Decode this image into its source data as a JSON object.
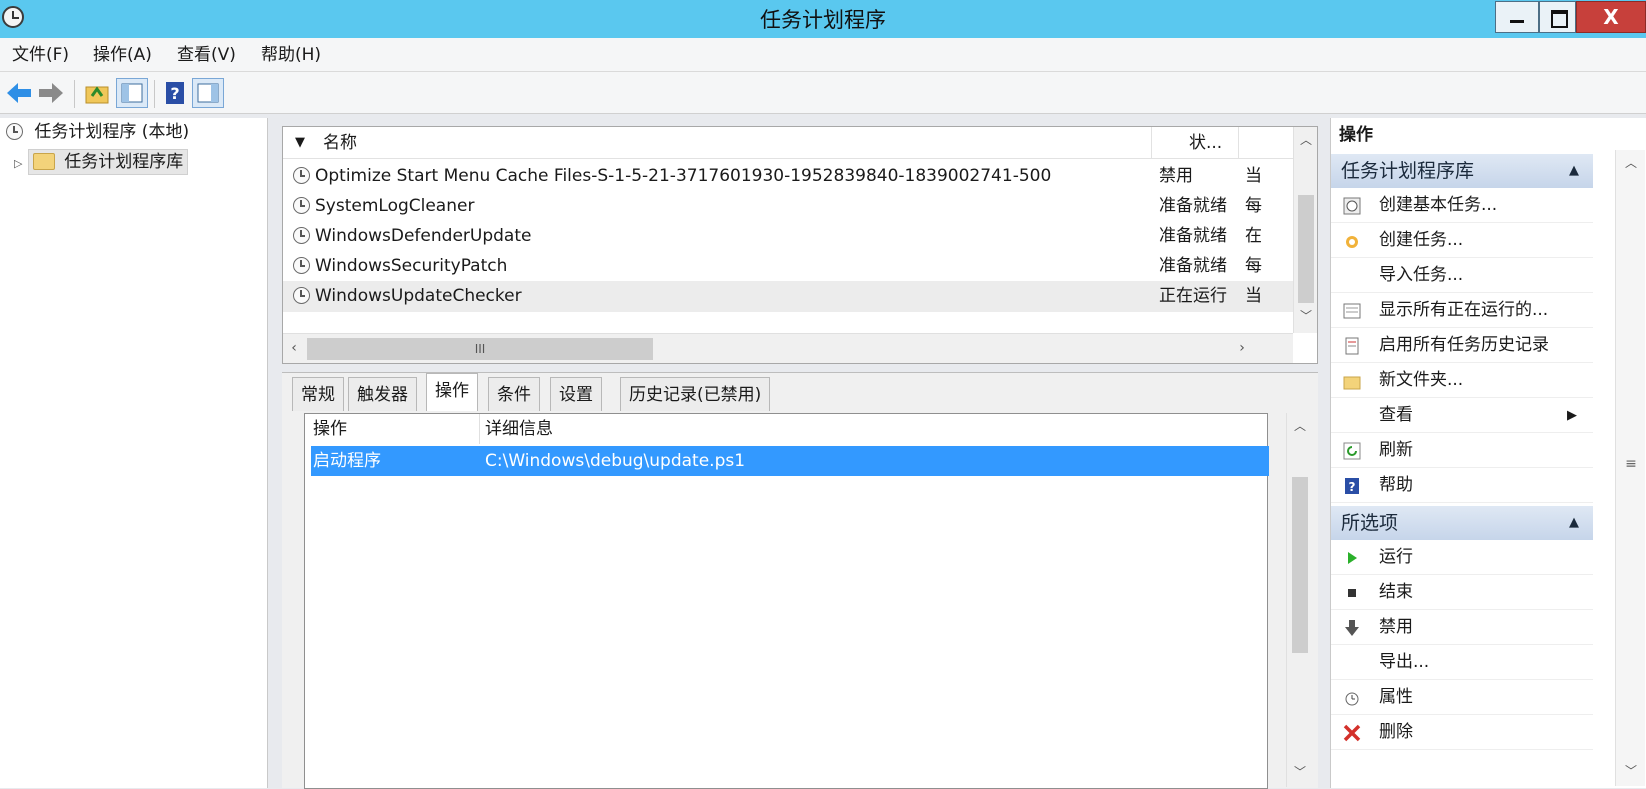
{
  "window": {
    "title": "任务计划程序"
  },
  "menu": [
    "文件(F)",
    "操作(A)",
    "查看(V)",
    "帮助(H)"
  ],
  "tree": {
    "root": "任务计划程序 (本地)",
    "library": "任务计划程序库"
  },
  "task_list": {
    "columns": {
      "name": "名称",
      "status": "状..."
    },
    "scroll_label": "III",
    "rows": [
      {
        "name": "Optimize Start Menu Cache Files-S-1-5-21-3717601930-1952839840-1839002741-500",
        "status": "禁用",
        "trigger": "当"
      },
      {
        "name": "SystemLogCleaner",
        "status": "准备就绪",
        "trigger": "每"
      },
      {
        "name": "WindowsDefenderUpdate",
        "status": "准备就绪",
        "trigger": "在"
      },
      {
        "name": "WindowsSecurityPatch",
        "status": "准备就绪",
        "trigger": "每"
      },
      {
        "name": "WindowsUpdateChecker",
        "status": "正在运行",
        "trigger": "当"
      }
    ]
  },
  "tabs": [
    "常规",
    "触发器",
    "操作",
    "条件",
    "设置",
    "历史记录(已禁用)"
  ],
  "actions_table": {
    "columns": {
      "action": "操作",
      "details": "详细信息"
    },
    "rows": [
      {
        "action": "启动程序",
        "details": "C:\\Windows\\debug\\update.ps1"
      }
    ]
  },
  "right_pane": {
    "title": "操作",
    "section1": {
      "title": "任务计划程序库",
      "items": [
        "创建基本任务...",
        "创建任务...",
        "导入任务...",
        "显示所有正在运行的...",
        "启用所有任务历史记录",
        "新文件夹...",
        "查看",
        "刷新",
        "帮助"
      ]
    },
    "section2": {
      "title": "所选项",
      "items": [
        "运行",
        "结束",
        "禁用",
        "导出...",
        "属性",
        "删除"
      ]
    }
  },
  "colors": {
    "titlebar": "#5ac8ef",
    "selection": "#3399ff",
    "close": "#c7403b"
  }
}
